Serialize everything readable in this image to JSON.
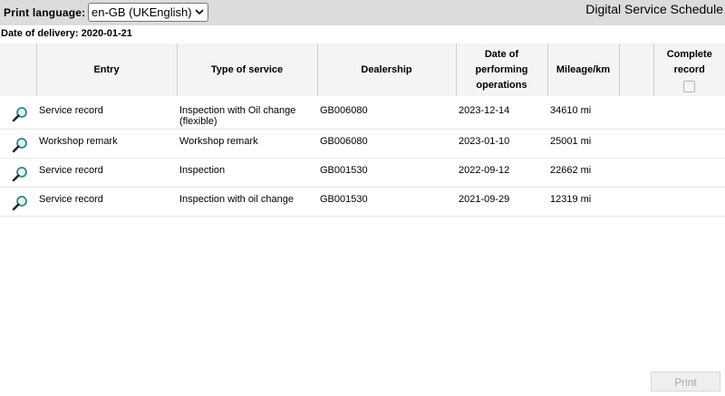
{
  "header": {
    "print_language_label": "Print language:",
    "print_language_value": "en-GB (UKEnglish)",
    "app_title": "Digital Service Schedule"
  },
  "delivery": {
    "text": "Date of delivery: 2020-01-21"
  },
  "table": {
    "columns": {
      "entry": "Entry",
      "type": "Type of service",
      "dealership": "Dealership",
      "date": "Date of performing operations",
      "mileage": "Mileage/km",
      "complete": "Complete record"
    },
    "rows": [
      {
        "entry": "Service record",
        "type": "Inspection with Oil change (flexible)",
        "dealership": "GB006080",
        "date": "2023-12-14",
        "mileage": "34610 mi"
      },
      {
        "entry": "Workshop remark",
        "type": "Workshop remark",
        "dealership": "GB006080",
        "date": "2023-01-10",
        "mileage": "25001 mi"
      },
      {
        "entry": "Service record",
        "type": "Inspection",
        "dealership": "GB001530",
        "date": "2022-09-12",
        "mileage": "22662 mi"
      },
      {
        "entry": "Service record",
        "type": "Inspection with oil change",
        "dealership": "GB001530",
        "date": "2021-09-29",
        "mileage": "12319 mi"
      }
    ]
  },
  "footer": {
    "print_label": "Print"
  },
  "icons": {
    "row_view": "magnifier-icon",
    "select_chevron": "chevron-down-icon"
  },
  "colors": {
    "topbar_bg": "#dcdcdc",
    "magnifier_lens": "#2f8a8a"
  }
}
